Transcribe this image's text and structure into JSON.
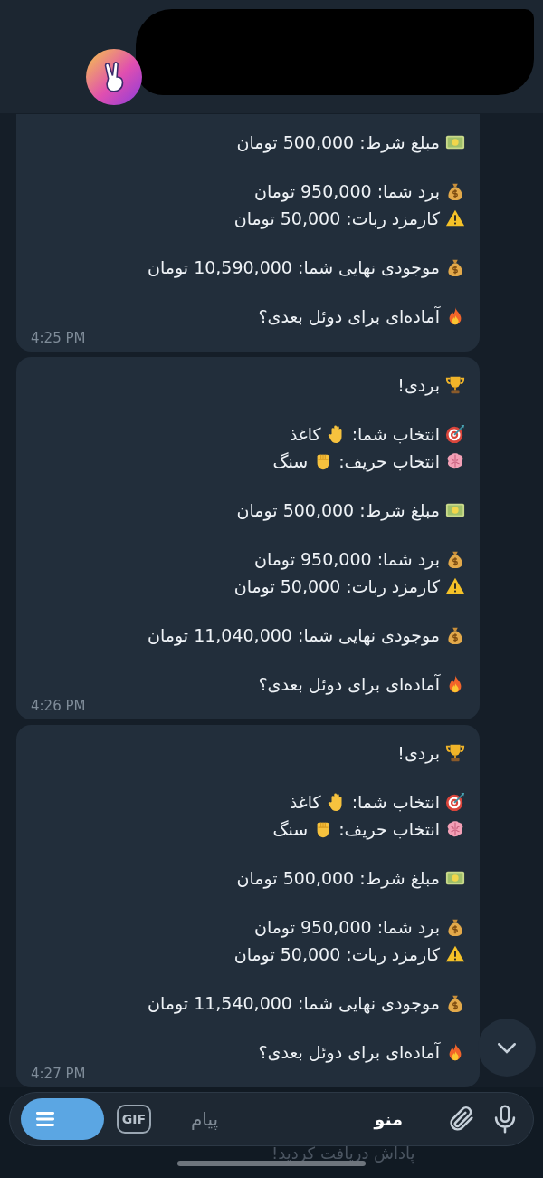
{
  "header": {
    "avatar": {
      "kind": "peace-hand"
    }
  },
  "messages": [
    {
      "paragraphs": [
        [
          {
            "kind": "money",
            "text": "مبلغ شرط: 500,000 تومان"
          }
        ],
        [
          {
            "kind": "moneybag",
            "text": "برد شما: 950,000 تومان"
          },
          {
            "kind": "warning",
            "text": "کارمزد ربات: 50,000 تومان"
          }
        ],
        [
          {
            "kind": "moneybag",
            "text": "موجودی نهایی شما: 10,590,000 تومان"
          }
        ],
        [
          {
            "kind": "fire",
            "text": "آماده‌ای برای دوئل بعدی؟"
          }
        ]
      ],
      "time": "4:25 PM",
      "cut_top": true
    },
    {
      "paragraphs": [
        [
          {
            "kind": "trophy",
            "text": "بردی!"
          }
        ],
        [
          {
            "kind": "target",
            "text": "انتخاب شما:",
            "pick": {
              "kind": "hand",
              "text": "کاغذ"
            }
          },
          {
            "kind": "brain",
            "text": "انتخاب حریف:",
            "pick": {
              "kind": "fist",
              "text": "سنگ"
            }
          }
        ],
        [
          {
            "kind": "money",
            "text": "مبلغ شرط: 500,000 تومان"
          }
        ],
        [
          {
            "kind": "moneybag",
            "text": "برد شما: 950,000 تومان"
          },
          {
            "kind": "warning",
            "text": "کارمزد ربات: 50,000 تومان"
          }
        ],
        [
          {
            "kind": "moneybag",
            "text": "موجودی نهایی شما: 11,040,000 تومان"
          }
        ],
        [
          {
            "kind": "fire",
            "text": "آماده‌ای برای دوئل بعدی؟"
          }
        ]
      ],
      "time": "4:26 PM",
      "cut_top": false
    },
    {
      "paragraphs": [
        [
          {
            "kind": "trophy",
            "text": "بردی!"
          }
        ],
        [
          {
            "kind": "target",
            "text": "انتخاب شما:",
            "pick": {
              "kind": "hand",
              "text": "کاغذ"
            }
          },
          {
            "kind": "brain",
            "text": "انتخاب حریف:",
            "pick": {
              "kind": "fist",
              "text": "سنگ"
            }
          }
        ],
        [
          {
            "kind": "money",
            "text": "مبلغ شرط: 500,000 تومان"
          }
        ],
        [
          {
            "kind": "moneybag",
            "text": "برد شما: 950,000 تومان"
          },
          {
            "kind": "warning",
            "text": "کارمزد ربات: 50,000 تومان"
          }
        ],
        [
          {
            "kind": "moneybag",
            "text": "موجودی نهایی شما: 11,540,000 تومان"
          }
        ],
        [
          {
            "kind": "fire",
            "text": "آماده‌ای برای دوئل بعدی؟"
          }
        ]
      ],
      "time": "4:27 PM",
      "cut_top": false
    }
  ],
  "composer": {
    "menu_label": "منو",
    "placeholder": "پیام",
    "gif": "GIF"
  },
  "below_text": "پاداش دریافت کردید!"
}
